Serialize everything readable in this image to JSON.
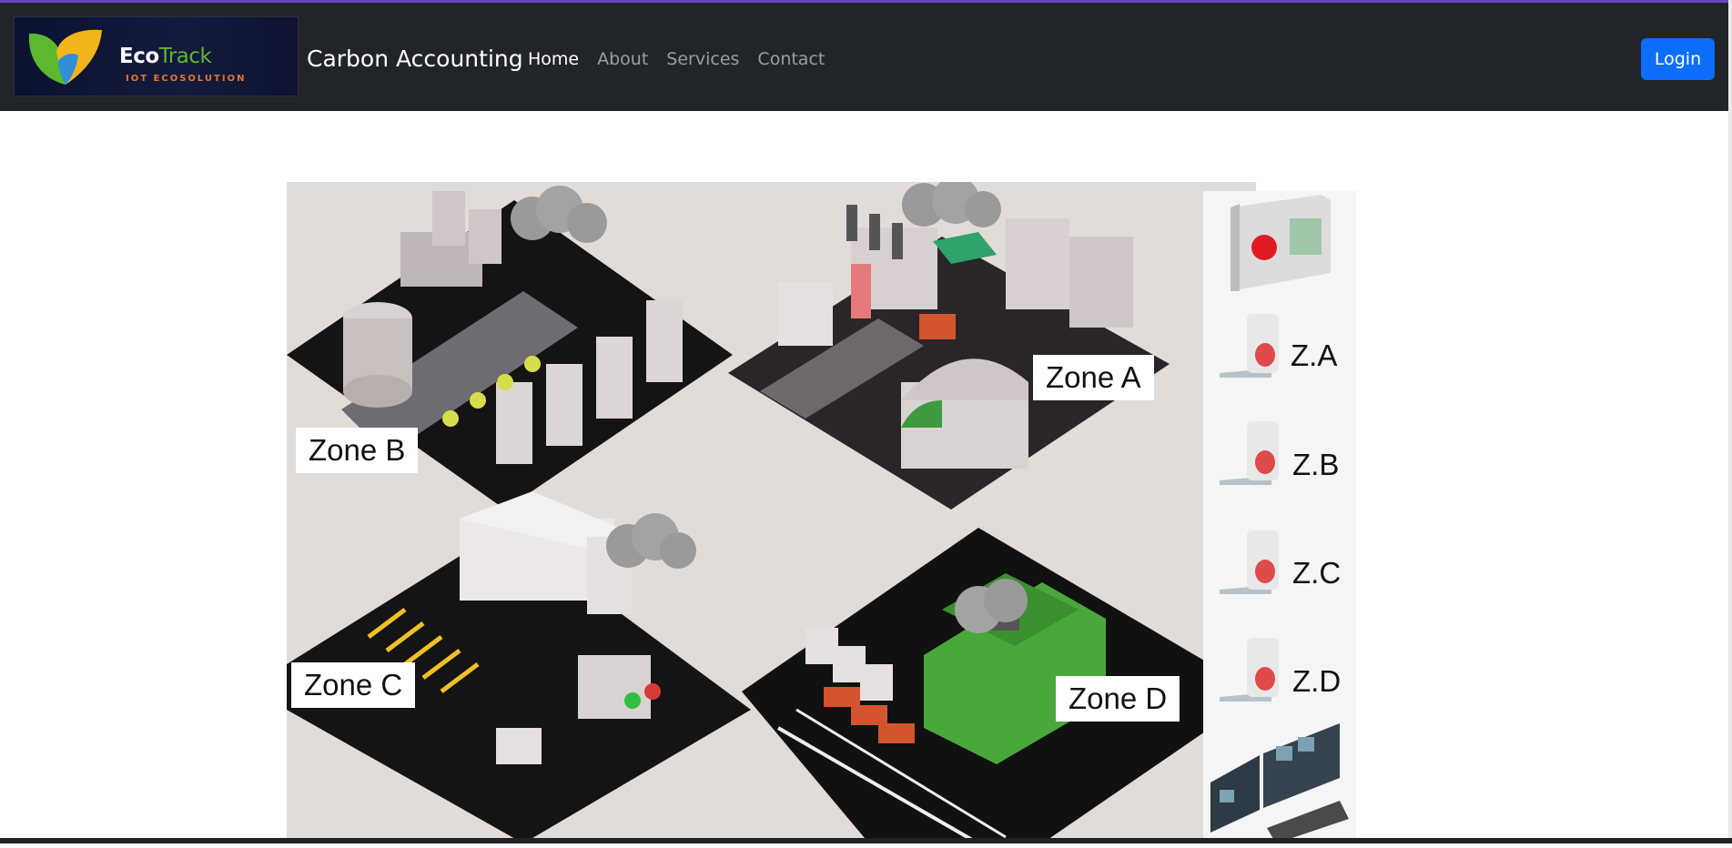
{
  "logo": {
    "name_primary": "Eco",
    "name_accent": "Track",
    "tagline": "IOT ECOSOLUTION"
  },
  "header": {
    "brand": "Carbon Accounting",
    "login_label": "Login"
  },
  "nav": [
    {
      "label": "Home",
      "active": true
    },
    {
      "label": "About",
      "active": false
    },
    {
      "label": "Services",
      "active": false
    },
    {
      "label": "Contact",
      "active": false
    }
  ],
  "zones": {
    "a": "Zone A",
    "b": "Zone B",
    "c": "Zone C",
    "d": "Zone D"
  },
  "sensors": {
    "a": "Z.A",
    "b": "Z.B",
    "c": "Z.C",
    "d": "Z.D"
  },
  "colors": {
    "navbar": "#212529",
    "accent_bar": "#6f42c1",
    "login": "#0d6efd",
    "scene_bg": "#e2dcd9"
  },
  "icons": [
    "eco-leaf-logo-icon",
    "control-panel-icon",
    "sensor-icon",
    "monitor-station-icon"
  ]
}
